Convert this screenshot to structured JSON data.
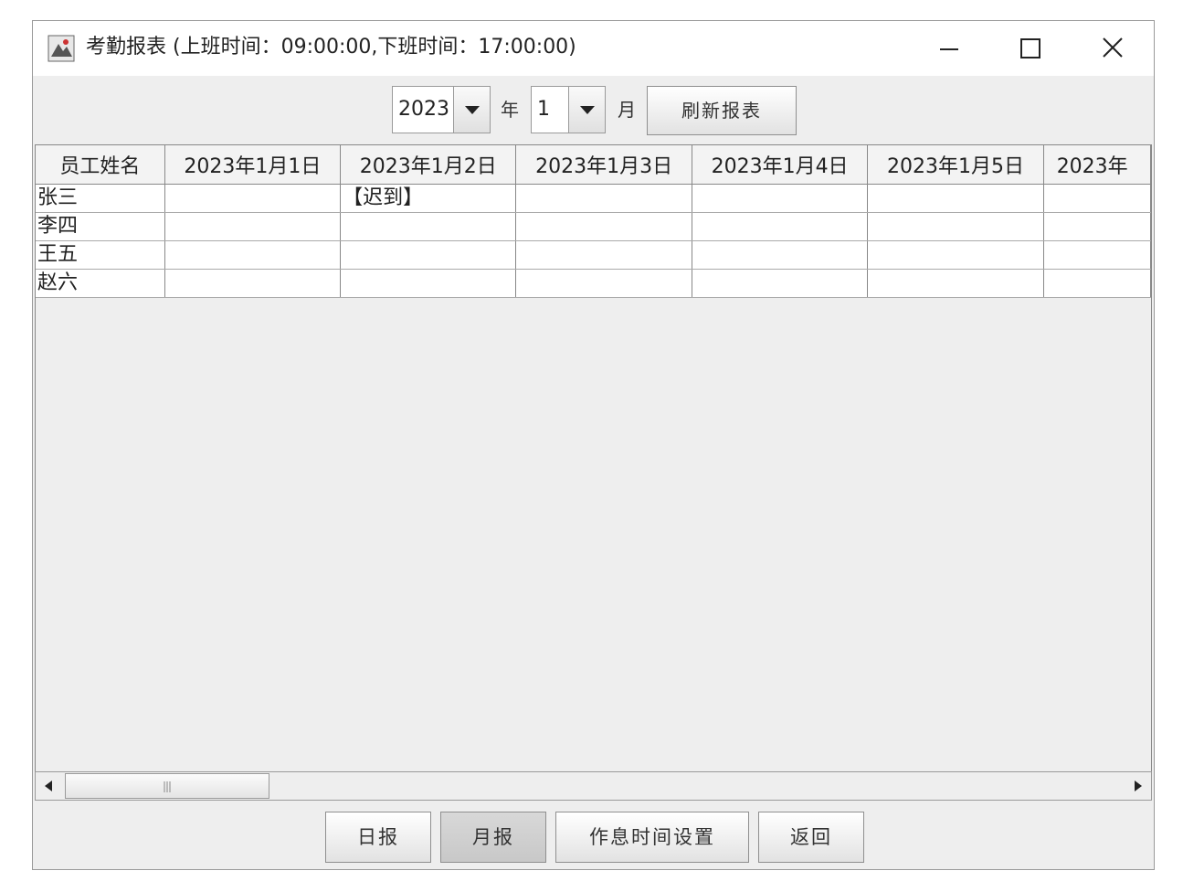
{
  "window": {
    "title": "考勤报表 (上班时间：09:00:00,下班时间：17:00:00)"
  },
  "toolbar": {
    "year_value": "2023",
    "year_label": "年",
    "month_value": "1",
    "month_label": "月",
    "refresh_label": "刷新报表"
  },
  "table": {
    "columns": [
      "员工姓名",
      "2023年1月1日",
      "2023年1月2日",
      "2023年1月3日",
      "2023年1月4日",
      "2023年1月5日",
      "2023年"
    ],
    "rows": [
      [
        "张三",
        "",
        "【迟到】",
        "",
        "",
        "",
        ""
      ],
      [
        "李四",
        "",
        "",
        "",
        "",
        "",
        ""
      ],
      [
        "王五",
        "",
        "",
        "",
        "",
        "",
        ""
      ],
      [
        "赵六",
        "",
        "",
        "",
        "",
        "",
        ""
      ]
    ]
  },
  "bottom": {
    "daily_label": "日报",
    "monthly_label": "月报",
    "schedule_label": "作息时间设置",
    "back_label": "返回"
  },
  "icons": {
    "app": "app-icon",
    "minimize": "minimize-icon",
    "maximize": "maximize-icon",
    "close": "close-icon",
    "dropdown": "chevron-down-icon",
    "scroll_left": "arrow-left-icon",
    "scroll_right": "arrow-right-icon"
  }
}
